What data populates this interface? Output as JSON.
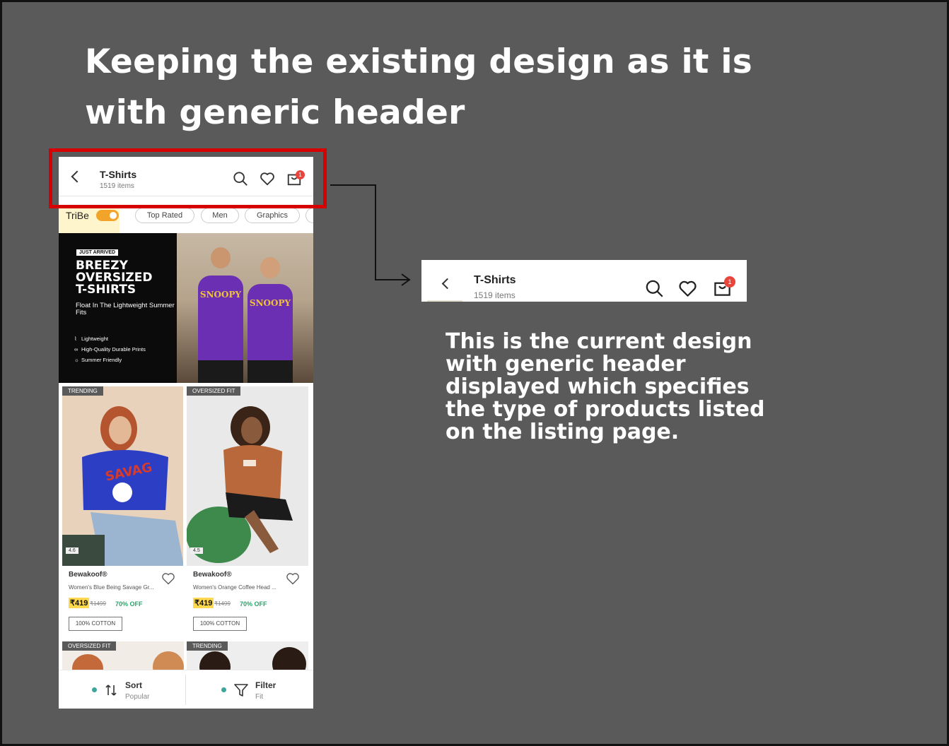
{
  "slide": {
    "title": "Keeping the existing design as it is with generic header",
    "description": "This is the current design with generic header displayed which specifies the type of products listed on the listing page."
  },
  "header": {
    "title": "T-Shirts",
    "subtitle": "1519 items",
    "cart_count": "1",
    "icons": [
      "back-arrow-icon",
      "search-icon",
      "heart-icon",
      "bag-icon"
    ]
  },
  "filters": {
    "tribe_label": "TriBe",
    "tribe_toggle_on": true,
    "chips": [
      "Top Rated",
      "Men",
      "Graphics"
    ]
  },
  "banner": {
    "badge": "JUST ARRIVED",
    "headline_lines": [
      "BREEZY",
      "OVERSIZED",
      "T-SHIRTS"
    ],
    "subline": "Float In The Lightweight Summer Fits",
    "features": [
      "Lightweight",
      "High-Quality Durable Prints",
      "Summer Friendly"
    ],
    "tee_print": "SNOOPY"
  },
  "products": [
    {
      "tag": "TRENDING",
      "rating": "4.6",
      "brand": "Bewakoof®",
      "name": "Women's Blue Being Savage Gr...",
      "price": "₹419",
      "mrp": "₹1499",
      "discount": "70% OFF",
      "material": "100% COTTON"
    },
    {
      "tag": "OVERSIZED FIT",
      "rating": "4.5",
      "brand": "Bewakoof®",
      "name": "Women's Orange Coffee Head ...",
      "price": "₹419",
      "mrp": "₹1499",
      "discount": "70% OFF",
      "material": "100% COTTON"
    }
  ],
  "next_row_tags": [
    "OVERSIZED FIT",
    "TRENDING"
  ],
  "bottom_bar": {
    "sort_label": "Sort",
    "sort_value": "Popular",
    "filter_label": "Filter",
    "filter_value": "Fit"
  },
  "colors": {
    "slide_background": "#5a5a5a",
    "highlight_box": "#d60000",
    "badge": "#e8453c",
    "price_highlight": "#ffd84d",
    "discount": "#27a56b",
    "toggle": "#f2a42a"
  }
}
